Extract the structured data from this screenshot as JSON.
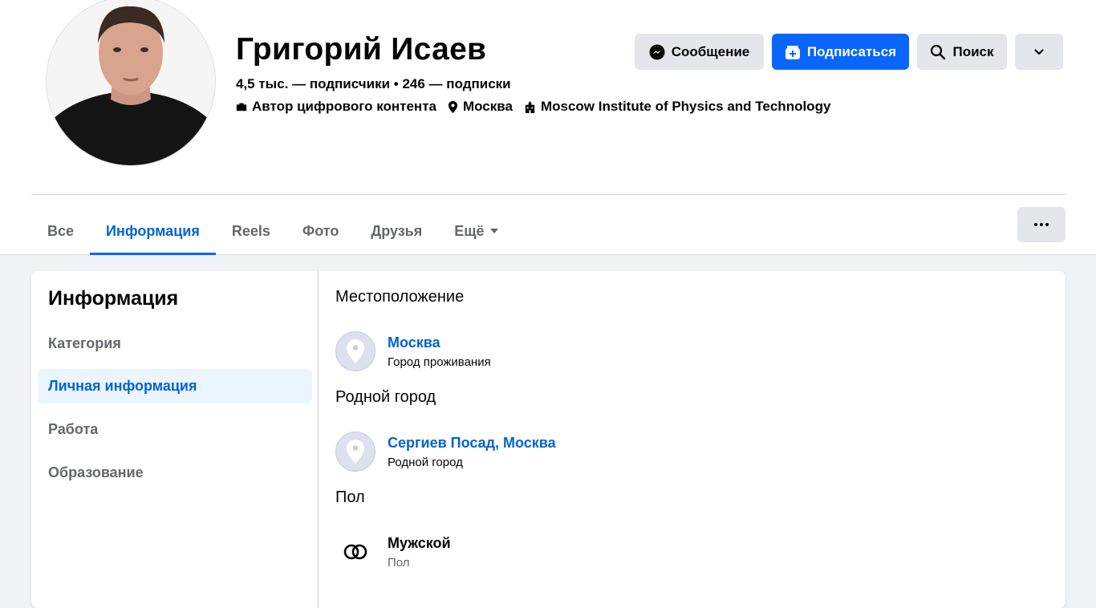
{
  "profile": {
    "name": "Григорий Исаев",
    "stats": "4,5 тыс. — подписчики • 246 — подписки",
    "meta": [
      {
        "icon": "briefcase-icon",
        "text": "Автор цифрового контента"
      },
      {
        "icon": "location-pin-icon",
        "text": "Москва"
      },
      {
        "icon": "building-icon",
        "text": "Moscow Institute of Physics and Technology"
      }
    ]
  },
  "actions": {
    "message_label": "Сообщение",
    "subscribe_label": "Подписаться",
    "search_label": "Поиск",
    "more_icon": "chevron-down-icon"
  },
  "tabs": [
    {
      "label": "Все",
      "active": false
    },
    {
      "label": "Информация",
      "active": true
    },
    {
      "label": "Reels",
      "active": false
    },
    {
      "label": "Фото",
      "active": false
    },
    {
      "label": "Друзья",
      "active": false
    },
    {
      "label": "Ещё",
      "active": false
    }
  ],
  "sidebar": {
    "title": "Информация",
    "items": [
      {
        "label": "Категория",
        "active": false
      },
      {
        "label": "Личная информация",
        "active": true
      },
      {
        "label": "Работа",
        "active": false
      },
      {
        "label": "Образование",
        "active": false
      }
    ]
  },
  "details": {
    "location": {
      "title": "Местоположение",
      "value": "Москва",
      "sub": "Город проживания"
    },
    "hometown": {
      "title": "Родной город",
      "value": "Сергиев Посад, Москва",
      "sub": "Родной город"
    },
    "gender": {
      "title": "Пол",
      "value": "Мужской",
      "sub": "Пол"
    }
  },
  "colors": {
    "accent": "#0866ff",
    "link": "#0064d1",
    "active_bg": "#ebf5ff",
    "page_bg": "#f0f2f5",
    "button_grey": "#e4e6eb"
  }
}
